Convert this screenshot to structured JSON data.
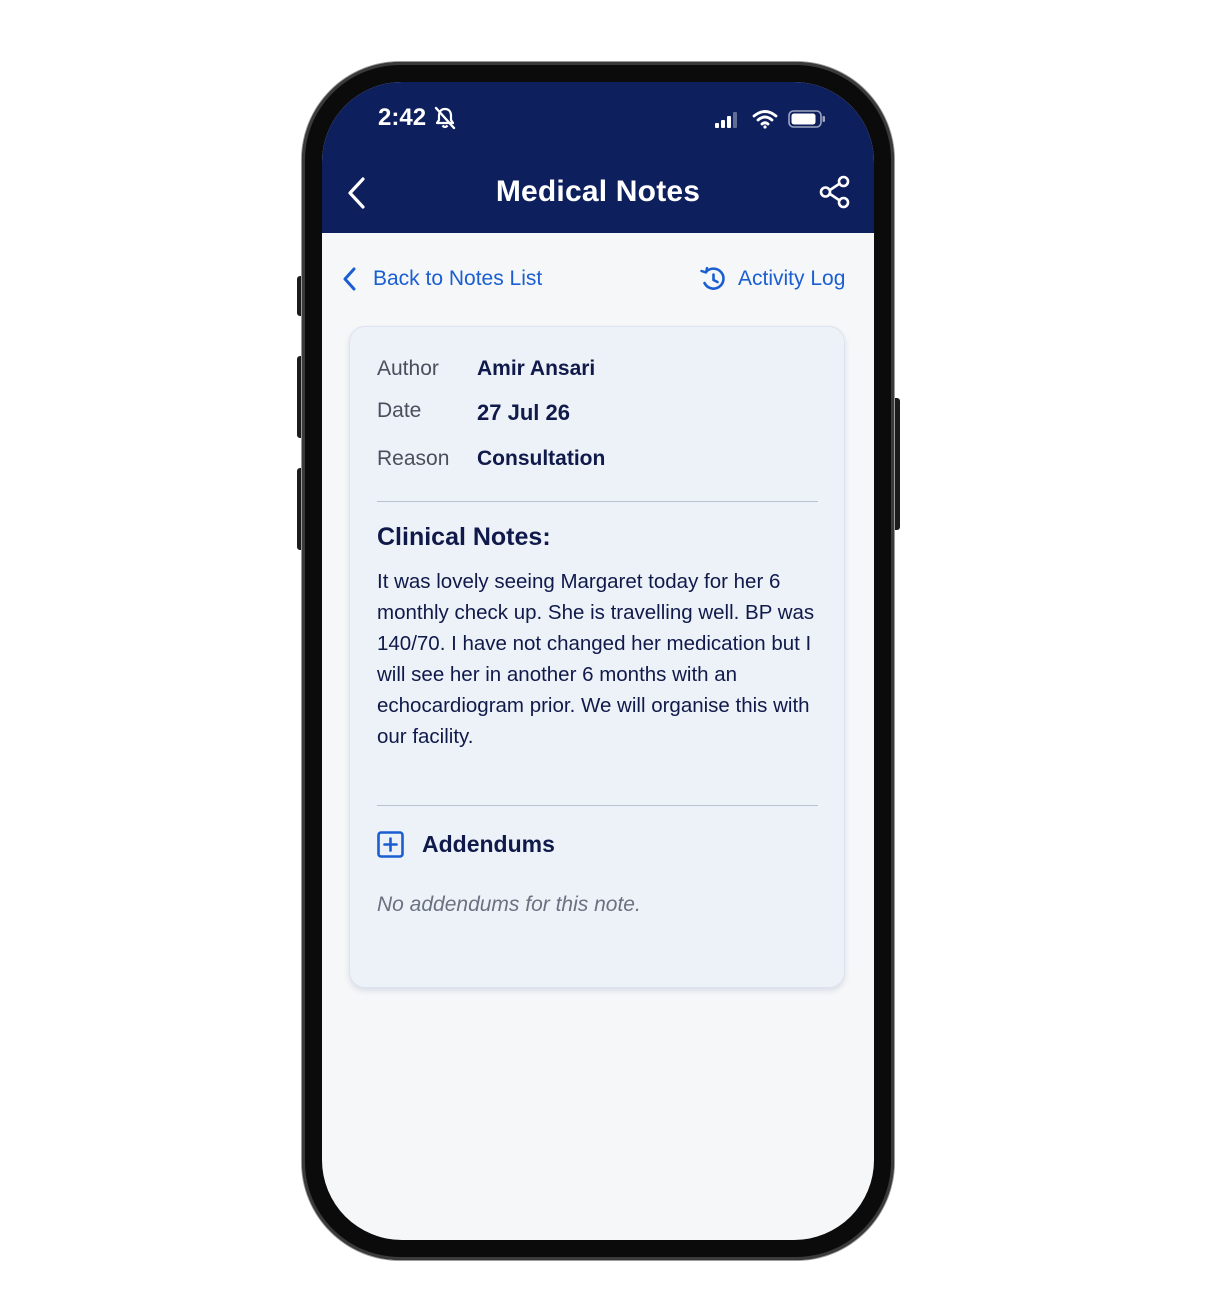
{
  "status_bar": {
    "time": "2:42"
  },
  "nav": {
    "title": "Medical Notes"
  },
  "links": {
    "back": "Back to Notes List",
    "activity": "Activity Log"
  },
  "note": {
    "meta": [
      {
        "key": "Author",
        "value": "Amir Ansari"
      },
      {
        "key": "Date",
        "value": "27 Jul 26"
      },
      {
        "key": "Reason",
        "value": "Consultation"
      }
    ],
    "clinical_title": "Clinical Notes:",
    "clinical_text": "It was lovely seeing Margaret today for her 6 monthly check up. She is travelling well. BP was 140/70. I have not changed her medication but I will see her in another 6 months with an echocardiogram prior. We will organise this with our facility.",
    "addendums_label": "Addendums",
    "no_addendums": "No addendums for this note."
  },
  "colors": {
    "header": "#0d1f5c",
    "link": "#1a5ed1",
    "card": "#edf1f8",
    "text": "#0f1a4a"
  }
}
